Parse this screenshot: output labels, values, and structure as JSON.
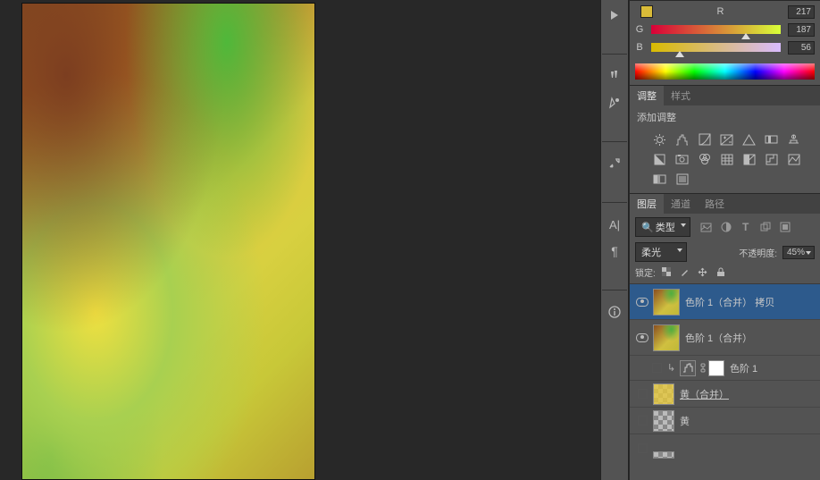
{
  "swatch_label": "R",
  "color": {
    "r": {
      "label": "R",
      "value": "217"
    },
    "g": {
      "label": "G",
      "value": "187"
    },
    "b": {
      "label": "B",
      "value": "56"
    }
  },
  "adjustments": {
    "tabs": {
      "adjust": "调整",
      "style": "样式"
    },
    "add_label": "添加调整"
  },
  "layers": {
    "tabs": {
      "layers": "图层",
      "channels": "通道",
      "paths": "路径"
    },
    "kind": "类型",
    "blend_mode": "柔光",
    "opacity_label": "不透明度:",
    "opacity_value": "45%",
    "lock_label": "锁定:",
    "items": [
      {
        "name": "色阶 1（合并） 拷贝"
      },
      {
        "name": "色阶 1（合并）"
      },
      {
        "name": "色阶 1"
      },
      {
        "name": "黄（合并）"
      },
      {
        "name": "黄"
      }
    ]
  }
}
